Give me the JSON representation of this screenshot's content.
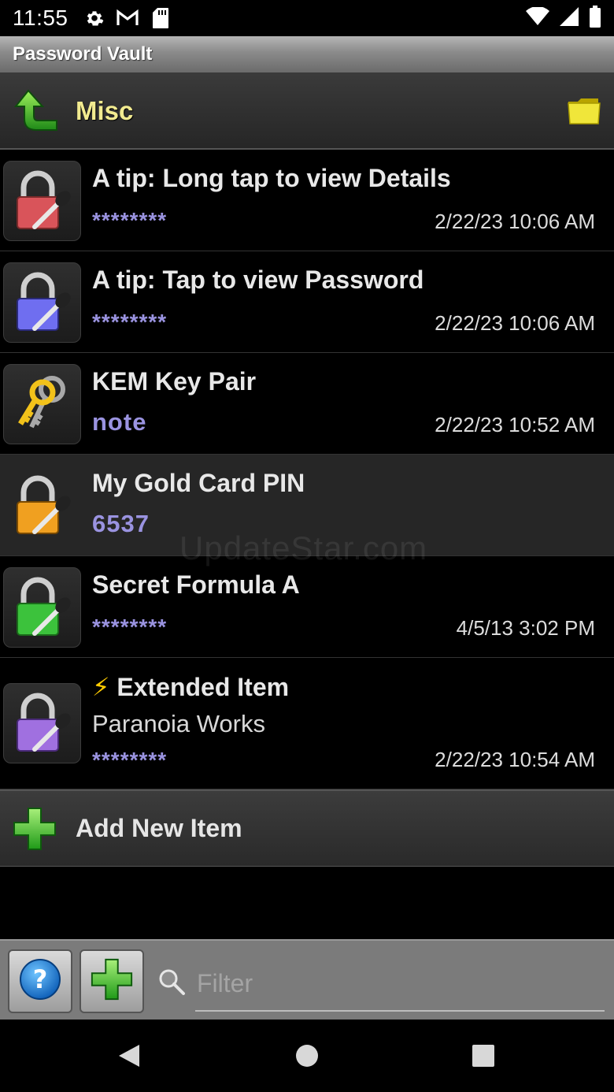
{
  "status_bar": {
    "time": "11:55",
    "left_icons": [
      "gear-icon",
      "gmail-icon",
      "sd-card-icon"
    ],
    "right_icons": [
      "wifi-icon",
      "cell-signal-icon",
      "battery-icon"
    ]
  },
  "app": {
    "title": "Password Vault"
  },
  "folder": {
    "name": "Misc",
    "name_color": "#f2eb90"
  },
  "items": [
    {
      "title": "A tip: Long tap to view Details",
      "value": "********",
      "date": "2/22/23 10:06 AM",
      "lock_color": "#d9545a",
      "icon": "lock-key-icon"
    },
    {
      "title": "A tip: Tap to view Password",
      "value": "********",
      "date": "2/22/23 10:06 AM",
      "lock_color": "#6f6ef0",
      "icon": "lock-key-icon"
    },
    {
      "title": "KEM Key Pair",
      "value": "note",
      "date": "2/22/23 10:52 AM",
      "icon": "keys-icon"
    },
    {
      "title": "My Gold Card PIN",
      "value": "6537",
      "date": "",
      "lock_color": "#f0a020",
      "icon": "lock-key-icon"
    },
    {
      "title": "Secret Formula A",
      "value": "********",
      "date": "4/5/13 3:02 PM",
      "lock_color": "#3cc23c",
      "icon": "lock-key-icon"
    },
    {
      "title": "Extended Item",
      "title_prefix": "⚡",
      "subtitle": "Paranoia Works",
      "value": "********",
      "date": "2/22/23 10:54 AM",
      "lock_color": "#a070e0",
      "icon": "lock-key-icon"
    }
  ],
  "add_item": {
    "label": "Add New Item"
  },
  "toolbar": {
    "filter_placeholder": "Filter"
  },
  "watermark": "UpdateStar.com",
  "colors": {
    "password_text": "#9a93e0",
    "title_bar": "#8a8a8a",
    "toolbar": "#7b7b7b"
  }
}
